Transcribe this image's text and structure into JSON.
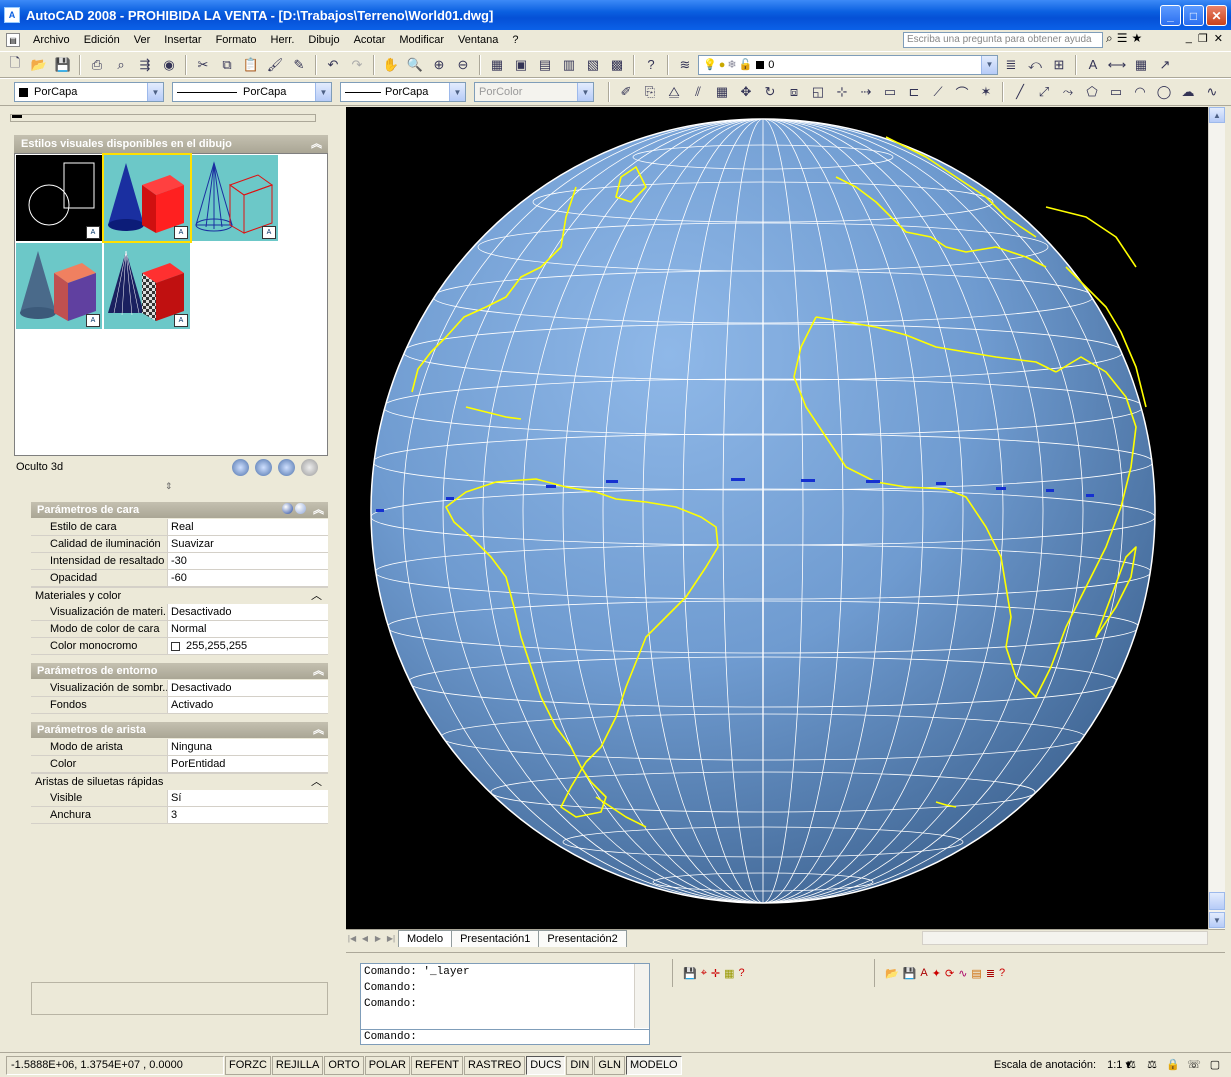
{
  "window": {
    "title": "AutoCAD 2008 - PROHIBIDA LA VENTA - [D:\\Trabajos\\Terreno\\World01.dwg]",
    "buttons": [
      "minimize",
      "maximize",
      "close"
    ]
  },
  "menu": {
    "items": [
      "Archivo",
      "Edición",
      "Ver",
      "Insertar",
      "Formato",
      "Herr.",
      "Dibujo",
      "Acotar",
      "Modificar",
      "Ventana",
      "?"
    ],
    "help_placeholder": "Escriba una pregunta para obtener ayuda"
  },
  "layer_toolbar": {
    "current_layer": "0"
  },
  "properties_toolbar": {
    "color": "PorCapa",
    "linetype": "PorCapa",
    "lineweight": "PorCapa",
    "plotstyle": "PorColor"
  },
  "visual_styles": {
    "header": "Estilos visuales disponibles en el dibujo",
    "current_name": "Oculto 3d",
    "thumbnails": [
      "wireframe-2d",
      "realistic",
      "wireframe-3d",
      "conceptual",
      "custom-checker"
    ]
  },
  "face_params": {
    "title": "Parámetros de cara",
    "rows": [
      {
        "name": "Estilo de cara",
        "value": "Real"
      },
      {
        "name": "Calidad de iluminación",
        "value": "Suavizar"
      },
      {
        "name": "Intensidad de resaltado",
        "value": "-30"
      },
      {
        "name": "Opacidad",
        "value": "-60"
      }
    ]
  },
  "materials": {
    "title": "Materiales y color",
    "rows": [
      {
        "name": "Visualización de materi...",
        "value": "Desactivado"
      },
      {
        "name": "Modo de color de cara",
        "value": "Normal"
      },
      {
        "name": "Color monocromo",
        "value": "255,255,255"
      }
    ]
  },
  "env_params": {
    "title": "Parámetros de entorno",
    "rows": [
      {
        "name": "Visualización de sombr...",
        "value": "Desactivado"
      },
      {
        "name": "Fondos",
        "value": "Activado"
      }
    ]
  },
  "edge_params": {
    "title": "Parámetros de arista",
    "rows": [
      {
        "name": "Modo de arista",
        "value": "Ninguna"
      },
      {
        "name": "Color",
        "value": "PorEntidad"
      }
    ]
  },
  "silhouette": {
    "title": "Aristas de siluetas rápidas",
    "rows": [
      {
        "name": "Visible",
        "value": "Sí"
      },
      {
        "name": "Anchura",
        "value": "3"
      }
    ]
  },
  "layout_tabs": [
    "Modelo",
    "Presentación1",
    "Presentación2"
  ],
  "command": {
    "history": [
      "Comando: '_layer",
      "Comando:",
      "Comando:"
    ],
    "prompt": "Comando:"
  },
  "status": {
    "coords": "-1.5888E+06, 1.3754E+07 , 0.0000",
    "toggles": [
      {
        "label": "FORZC",
        "on": false
      },
      {
        "label": "REJILLA",
        "on": false
      },
      {
        "label": "ORTO",
        "on": false
      },
      {
        "label": "POLAR",
        "on": false
      },
      {
        "label": "REFENT",
        "on": false
      },
      {
        "label": "RASTREO",
        "on": false
      },
      {
        "label": "DUCS",
        "on": true
      },
      {
        "label": "DIN",
        "on": false
      },
      {
        "label": "GLN",
        "on": false
      },
      {
        "label": "MODELO",
        "on": true
      }
    ],
    "annotation_scale_label": "Escala de anotación:",
    "annotation_scale": "1:1"
  },
  "colors": {
    "globe": "#6f9bd0",
    "coastline": "#ffff00",
    "graticule": "#ffffff",
    "viewport_bg": "#000000"
  }
}
